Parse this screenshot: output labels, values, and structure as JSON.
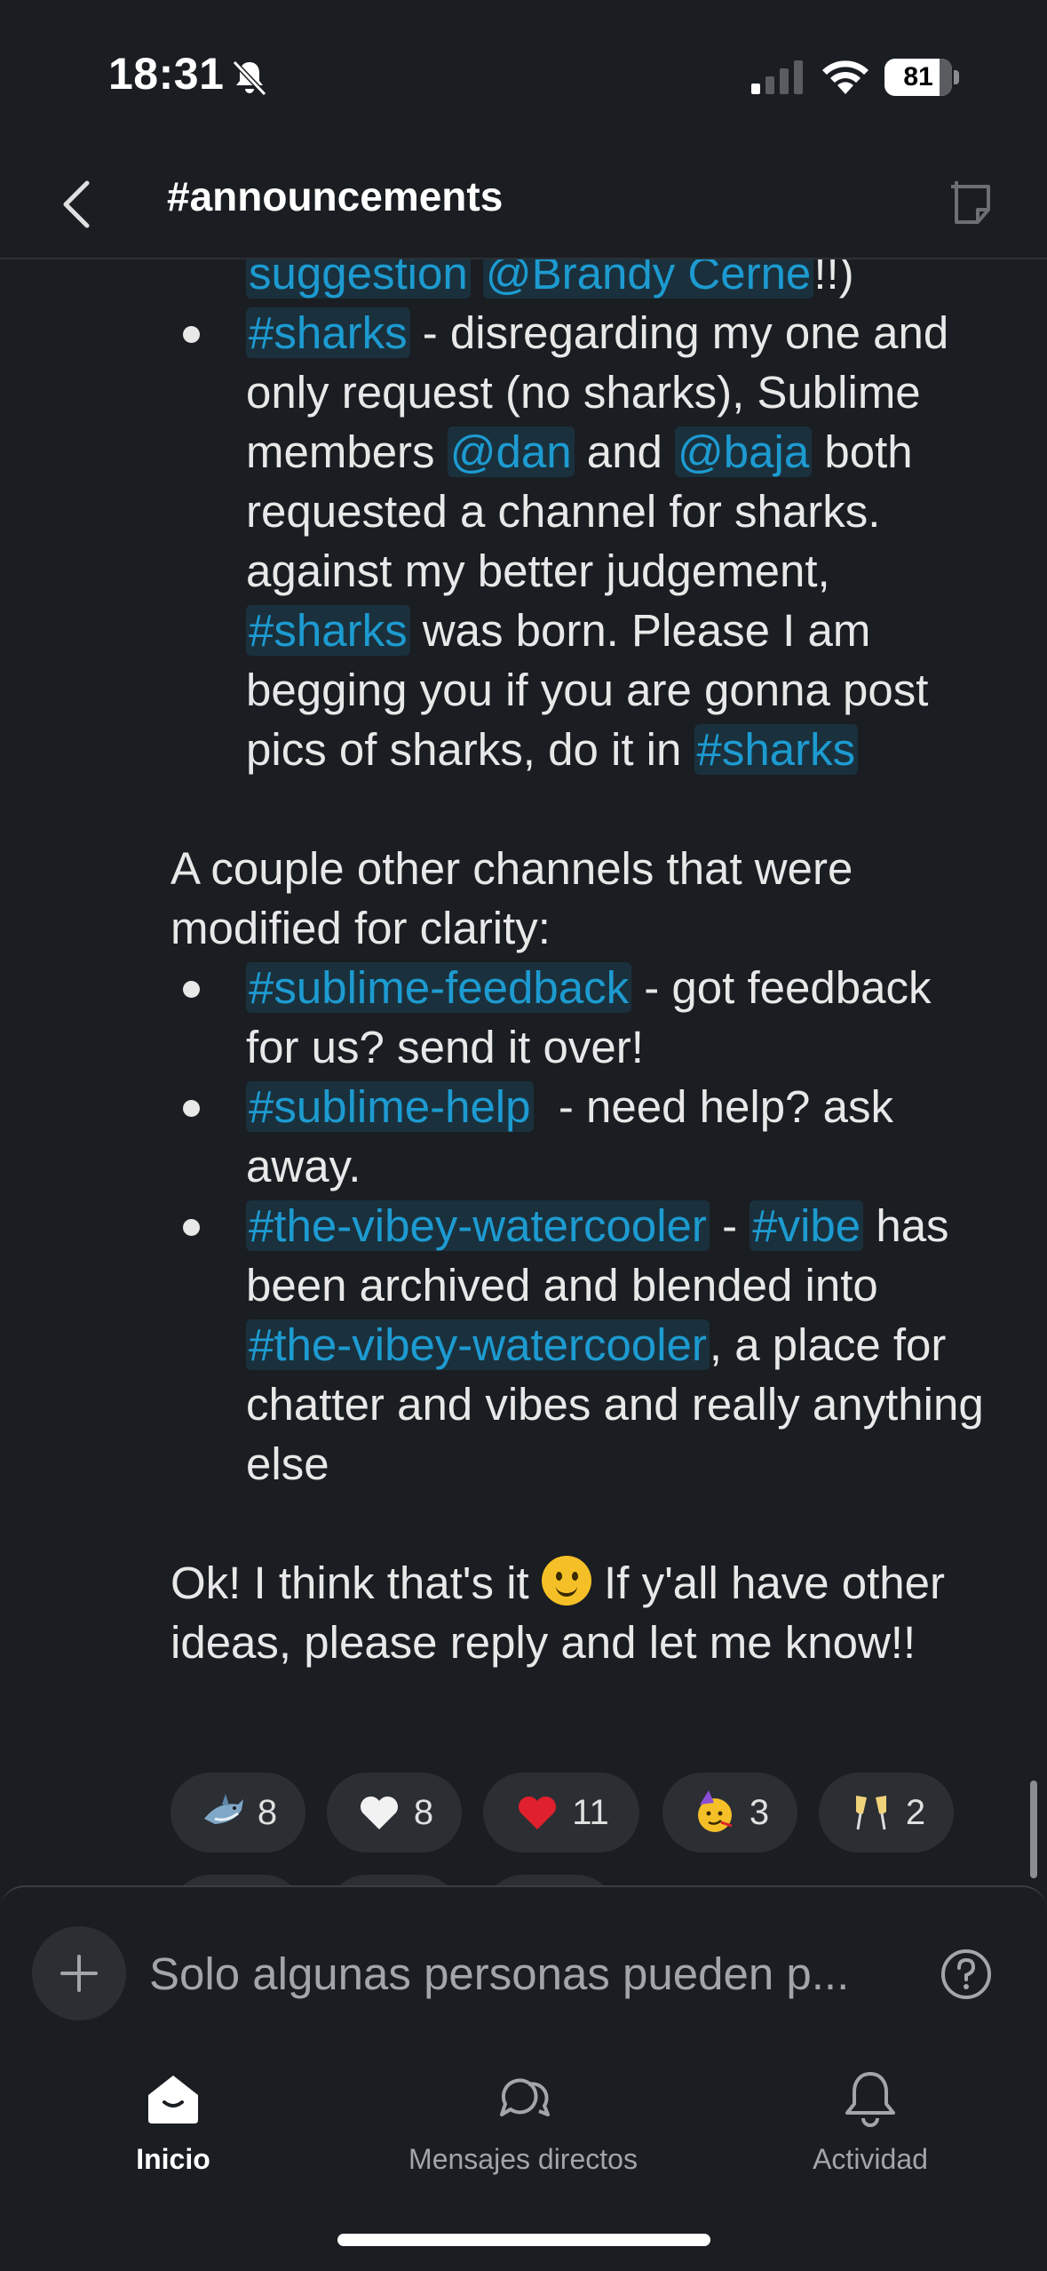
{
  "status_bar": {
    "time": "18:31",
    "battery": "81"
  },
  "header": {
    "channel_title": "#announcements"
  },
  "message": {
    "item1_tail": {
      "tag": "suggestion",
      "mention": "@Brandy Cerne",
      "end": "!!)"
    },
    "item_sharks": {
      "tag": "#sharks",
      "text1": " - disregarding my one and only request (no sharks), Sublime members ",
      "mention1": "@dan",
      "text2": " and ",
      "mention2": "@baja",
      "text3": " both requested a channel for sharks. against my better judgement, ",
      "tag2": "#sharks",
      "text4": " was born. Please I am begging you if you are gonna post pics of sharks, do it in ",
      "tag3": "#sharks"
    },
    "intro2": "A couple other channels that were modified for clarity:",
    "items2": [
      {
        "tag": "#sublime-feedback",
        "text": " - got feedback for us? send it over!"
      },
      {
        "tag": "#sublime-help",
        "text": "  - need help? ask away."
      }
    ],
    "item_vibey": {
      "tag": "#the-vibey-watercooler",
      "text1": " - ",
      "tag2": "#vibe",
      "text2": " has been archived and blended into ",
      "tag3": "#the-vibey-watercooler",
      "text3": ", a place for chatter and vibes and really anything else"
    },
    "closing1": "Ok! I think that's it ",
    "closing_emoji": "slightly-smiling-face",
    "closing2": " If y'all have other ideas, please reply and let me know!!"
  },
  "reactions": [
    {
      "emoji": "shark",
      "count": "8"
    },
    {
      "emoji": "white-heart",
      "count": "8"
    },
    {
      "emoji": "red-heart",
      "count": "11"
    },
    {
      "emoji": "partying-face",
      "count": "3"
    },
    {
      "emoji": "clinking-glasses",
      "count": "2"
    }
  ],
  "composer": {
    "placeholder": "Solo algunas personas pueden p..."
  },
  "tabbar": {
    "items": [
      {
        "label": "Inicio",
        "icon": "home-icon",
        "active": true
      },
      {
        "label": "Mensajes directos",
        "icon": "messages-icon",
        "active": false
      },
      {
        "label": "Actividad",
        "icon": "bell-icon",
        "active": false
      }
    ]
  },
  "colors": {
    "background": "#1a1d21",
    "link": "#1d9bd1",
    "text": "#e8e8e8"
  }
}
